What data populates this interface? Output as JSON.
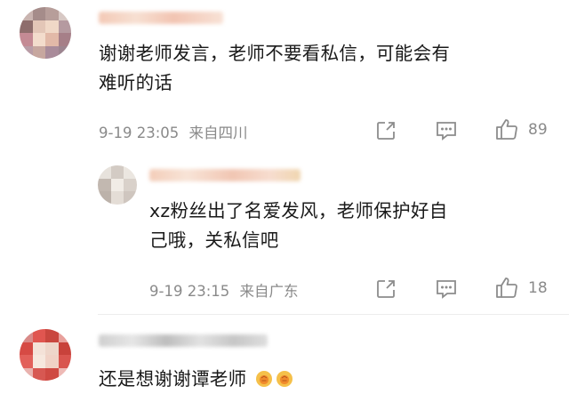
{
  "comments": [
    {
      "text_line1": "谢谢老师发言，老师不要看私信，可能会有",
      "text_line2": "难听的话",
      "time": "9-19 23:05",
      "location": "来自四川",
      "like_count": "89"
    },
    {
      "text_line1": "xz粉丝出了名爱发风，老师保护好自",
      "text_line2": "己哦，关私信吧",
      "time": "9-19 23:15",
      "location": "来自广东",
      "like_count": "18"
    },
    {
      "text": "还是想谢谢谭老师"
    }
  ],
  "icons": {
    "share": "share-icon",
    "reply": "comment-icon",
    "like": "thumbs-up-icon",
    "emoji": "clap-emoji-icon"
  },
  "colors": {
    "text": "#1a1a1a",
    "meta": "#8a8a8a",
    "divider": "#ececec",
    "emoji": "#f2b43c"
  }
}
